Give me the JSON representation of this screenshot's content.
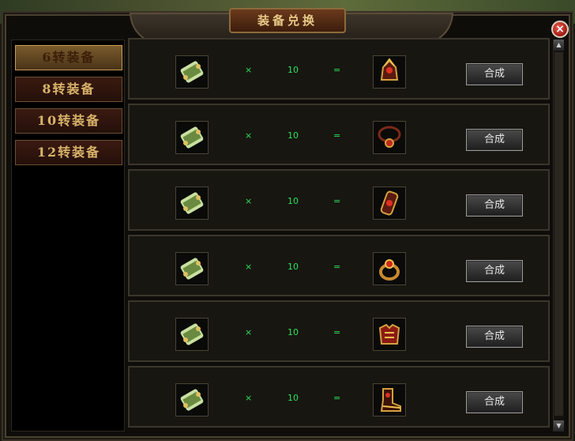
{
  "window": {
    "title": "装备兑换",
    "close_label": "×"
  },
  "tabs": [
    {
      "label": "6转装备",
      "active": true
    },
    {
      "label": "8转装备",
      "active": false
    },
    {
      "label": "10转装备",
      "active": false
    },
    {
      "label": "12转装备",
      "active": false
    }
  ],
  "recipes": [
    {
      "source_icon": "scroll-icon",
      "multiplier": "×",
      "quantity": "10",
      "equals": "=",
      "result_icon": "helmet-icon",
      "button_label": "合成"
    },
    {
      "source_icon": "scroll-icon",
      "multiplier": "×",
      "quantity": "10",
      "equals": "=",
      "result_icon": "necklace-icon",
      "button_label": "合成"
    },
    {
      "source_icon": "scroll-icon",
      "multiplier": "×",
      "quantity": "10",
      "equals": "=",
      "result_icon": "bracelet-icon",
      "button_label": "合成"
    },
    {
      "source_icon": "scroll-icon",
      "multiplier": "×",
      "quantity": "10",
      "equals": "=",
      "result_icon": "ring-icon",
      "button_label": "合成"
    },
    {
      "source_icon": "scroll-icon",
      "multiplier": "×",
      "quantity": "10",
      "equals": "=",
      "result_icon": "armor-icon",
      "button_label": "合成"
    },
    {
      "source_icon": "scroll-icon",
      "multiplier": "×",
      "quantity": "10",
      "equals": "=",
      "result_icon": "boots-icon",
      "button_label": "合成"
    }
  ],
  "scrollbar": {
    "up": "▲",
    "down": "▼"
  },
  "colors": {
    "accent_green": "#2ee05a",
    "title_gold": "#e8c987",
    "tab_gold": "#d9b36a"
  }
}
